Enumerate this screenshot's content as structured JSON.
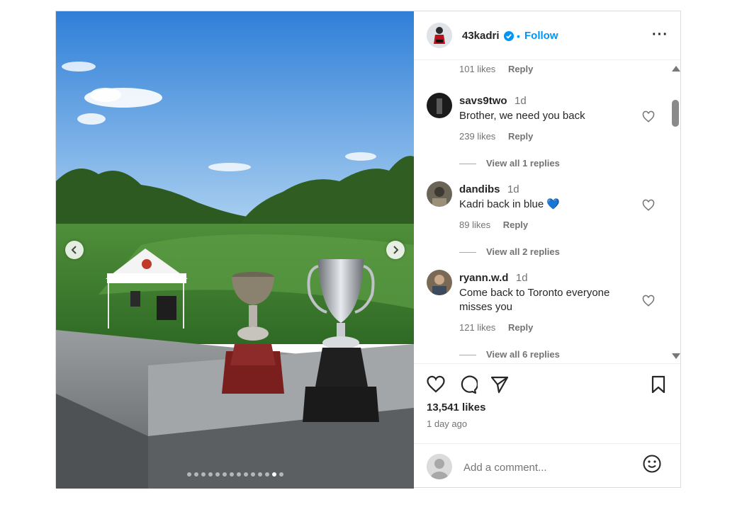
{
  "post": {
    "username": "43kadri",
    "follow_label": "Follow",
    "separator": "•",
    "more_icon": "more-horizontal-icon",
    "likes": "13,541 likes",
    "time_ago": "1 day ago",
    "add_comment_placeholder": "Add a comment...",
    "carousel": {
      "total": 14,
      "active_index": 12
    }
  },
  "comments": {
    "top_partial": {
      "likes": "101 likes",
      "reply": "Reply"
    },
    "items": [
      {
        "user": "savs9two",
        "time": "1d",
        "text": "Brother, we need you back",
        "likes": "239 likes",
        "reply": "Reply",
        "view_replies": "View all 1 replies"
      },
      {
        "user": "dandibs",
        "time": "1d",
        "text": "Kadri back in blue 💙",
        "likes": "89 likes",
        "reply": "Reply",
        "view_replies": "View all 2 replies"
      },
      {
        "user": "ryann.w.d",
        "time": "1d",
        "text": "Come back to Toronto everyone misses you",
        "likes": "121 likes",
        "reply": "Reply",
        "view_replies": "View all 6 replies"
      }
    ]
  },
  "colors": {
    "link_blue": "#0095f6",
    "verified_blue": "#0095f6",
    "muted": "#737373"
  }
}
